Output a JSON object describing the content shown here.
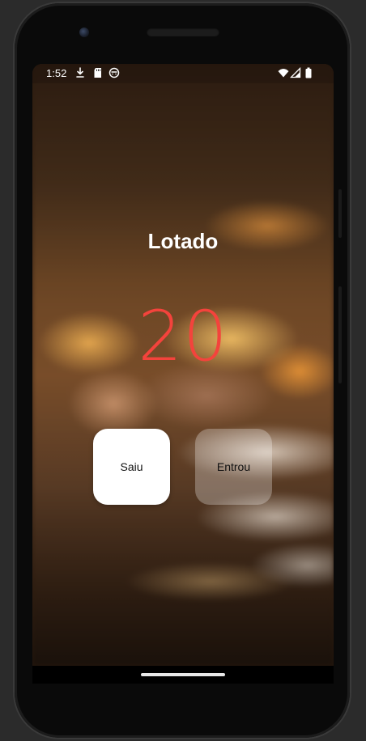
{
  "status_bar": {
    "time": "1:52",
    "left_icons": [
      "download-icon",
      "sd-card-icon",
      "face-circle-icon"
    ],
    "right_icons": [
      "wifi-icon",
      "signal-icon",
      "battery-icon"
    ]
  },
  "main": {
    "title": "Lotado",
    "counter": "20",
    "counter_color": "#f4433c"
  },
  "buttons": {
    "saiu_label": "Saiu",
    "entrou_label": "Entrou"
  }
}
